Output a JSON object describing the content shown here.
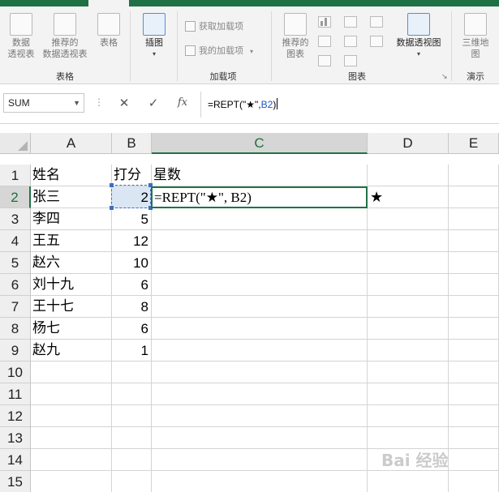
{
  "ribbon": {
    "groups": [
      {
        "label": "表格",
        "buttons": [
          "数据\n透视表",
          "推荐的\n数据透视表",
          "表格"
        ]
      },
      {
        "label": "",
        "buttons": [
          "插图"
        ]
      },
      {
        "label": "加载项",
        "items": [
          "获取加载项",
          "我的加载项"
        ]
      },
      {
        "label": "图表",
        "buttons": [
          "推荐的\n图表",
          "数据透视图"
        ]
      },
      {
        "label": "演示",
        "buttons": [
          "三维地\n图"
        ]
      }
    ]
  },
  "formula_bar": {
    "name_box": "SUM",
    "cancel_icon": "✕",
    "enter_icon": "✓",
    "fx_label": "fx",
    "formula_prefix": "=REPT(\"★\",",
    "formula_ref": "B2",
    "formula_suffix": ")"
  },
  "grid": {
    "columns": [
      "A",
      "B",
      "C",
      "D",
      "E"
    ],
    "rows": [
      "1",
      "2",
      "3",
      "4",
      "5",
      "6",
      "7",
      "8",
      "9",
      "10",
      "11",
      "12",
      "13",
      "14",
      "15"
    ],
    "header_row": {
      "name": "姓名",
      "score": "打分",
      "stars": "星数"
    },
    "records": [
      {
        "name": "张三",
        "score": "2"
      },
      {
        "name": "李四",
        "score": "5"
      },
      {
        "name": "王五",
        "score": "12"
      },
      {
        "name": "赵六",
        "score": "10"
      },
      {
        "name": "刘十九",
        "score": "6"
      },
      {
        "name": "王十七",
        "score": "8"
      },
      {
        "name": "杨七",
        "score": "6"
      },
      {
        "name": "赵九",
        "score": "1"
      }
    ],
    "editing_cell_text": "=REPT(\"★\", B2)",
    "d2_value": "★"
  },
  "watermark": "Bai 经验",
  "colors": {
    "excel_green": "#217346",
    "ref_blue": "#1f55c8"
  }
}
